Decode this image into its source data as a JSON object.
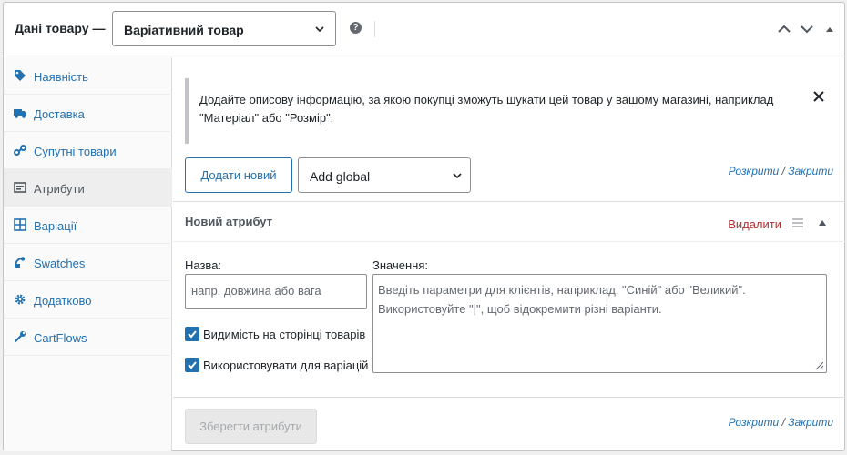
{
  "header": {
    "title": "Дані товару —",
    "product_type": "Варіативний товар"
  },
  "sidebar": {
    "items": [
      {
        "label": "Наявність",
        "icon": "tag-icon"
      },
      {
        "label": "Доставка",
        "icon": "truck-icon"
      },
      {
        "label": "Супутні товари",
        "icon": "link-icon"
      },
      {
        "label": "Атрибути",
        "icon": "list-icon",
        "active": true
      },
      {
        "label": "Варіації",
        "icon": "grid-icon"
      },
      {
        "label": "Swatches",
        "icon": "swatches-icon"
      },
      {
        "label": "Додатково",
        "icon": "gear-icon"
      },
      {
        "label": "CartFlows",
        "icon": "wrench-icon"
      }
    ]
  },
  "notice": {
    "text": "Додайте описову інформацію, за якою покупці зможуть шукати цей товар у вашому магазині, наприклад \"Матеріал\" або \"Розмір\"."
  },
  "toolbar": {
    "add_new_label": "Додати новий",
    "add_global_label": "Add global",
    "expand_label": "Розкрити",
    "separator": "/",
    "collapse_label": "Закрити"
  },
  "attribute": {
    "title": "Новий атрибут",
    "remove_label": "Видалити",
    "name_label": "Назва:",
    "name_placeholder": "напр. довжина або вага",
    "values_label": "Значення:",
    "values_placeholder": "Введіть параметри для клієнтів, наприклад, \"Синій\" або \"Великий\". Використовуйте \"|\", щоб відокремити різні варіанти.",
    "visible_label": "Видимість на сторінці товарів",
    "visible_checked": true,
    "variations_label": "Використовувати для варіацій",
    "variations_checked": true
  },
  "footer": {
    "save_label": "Зберегти атрибути"
  },
  "colors": {
    "accent": "#2271b1",
    "danger": "#b32d2e"
  }
}
